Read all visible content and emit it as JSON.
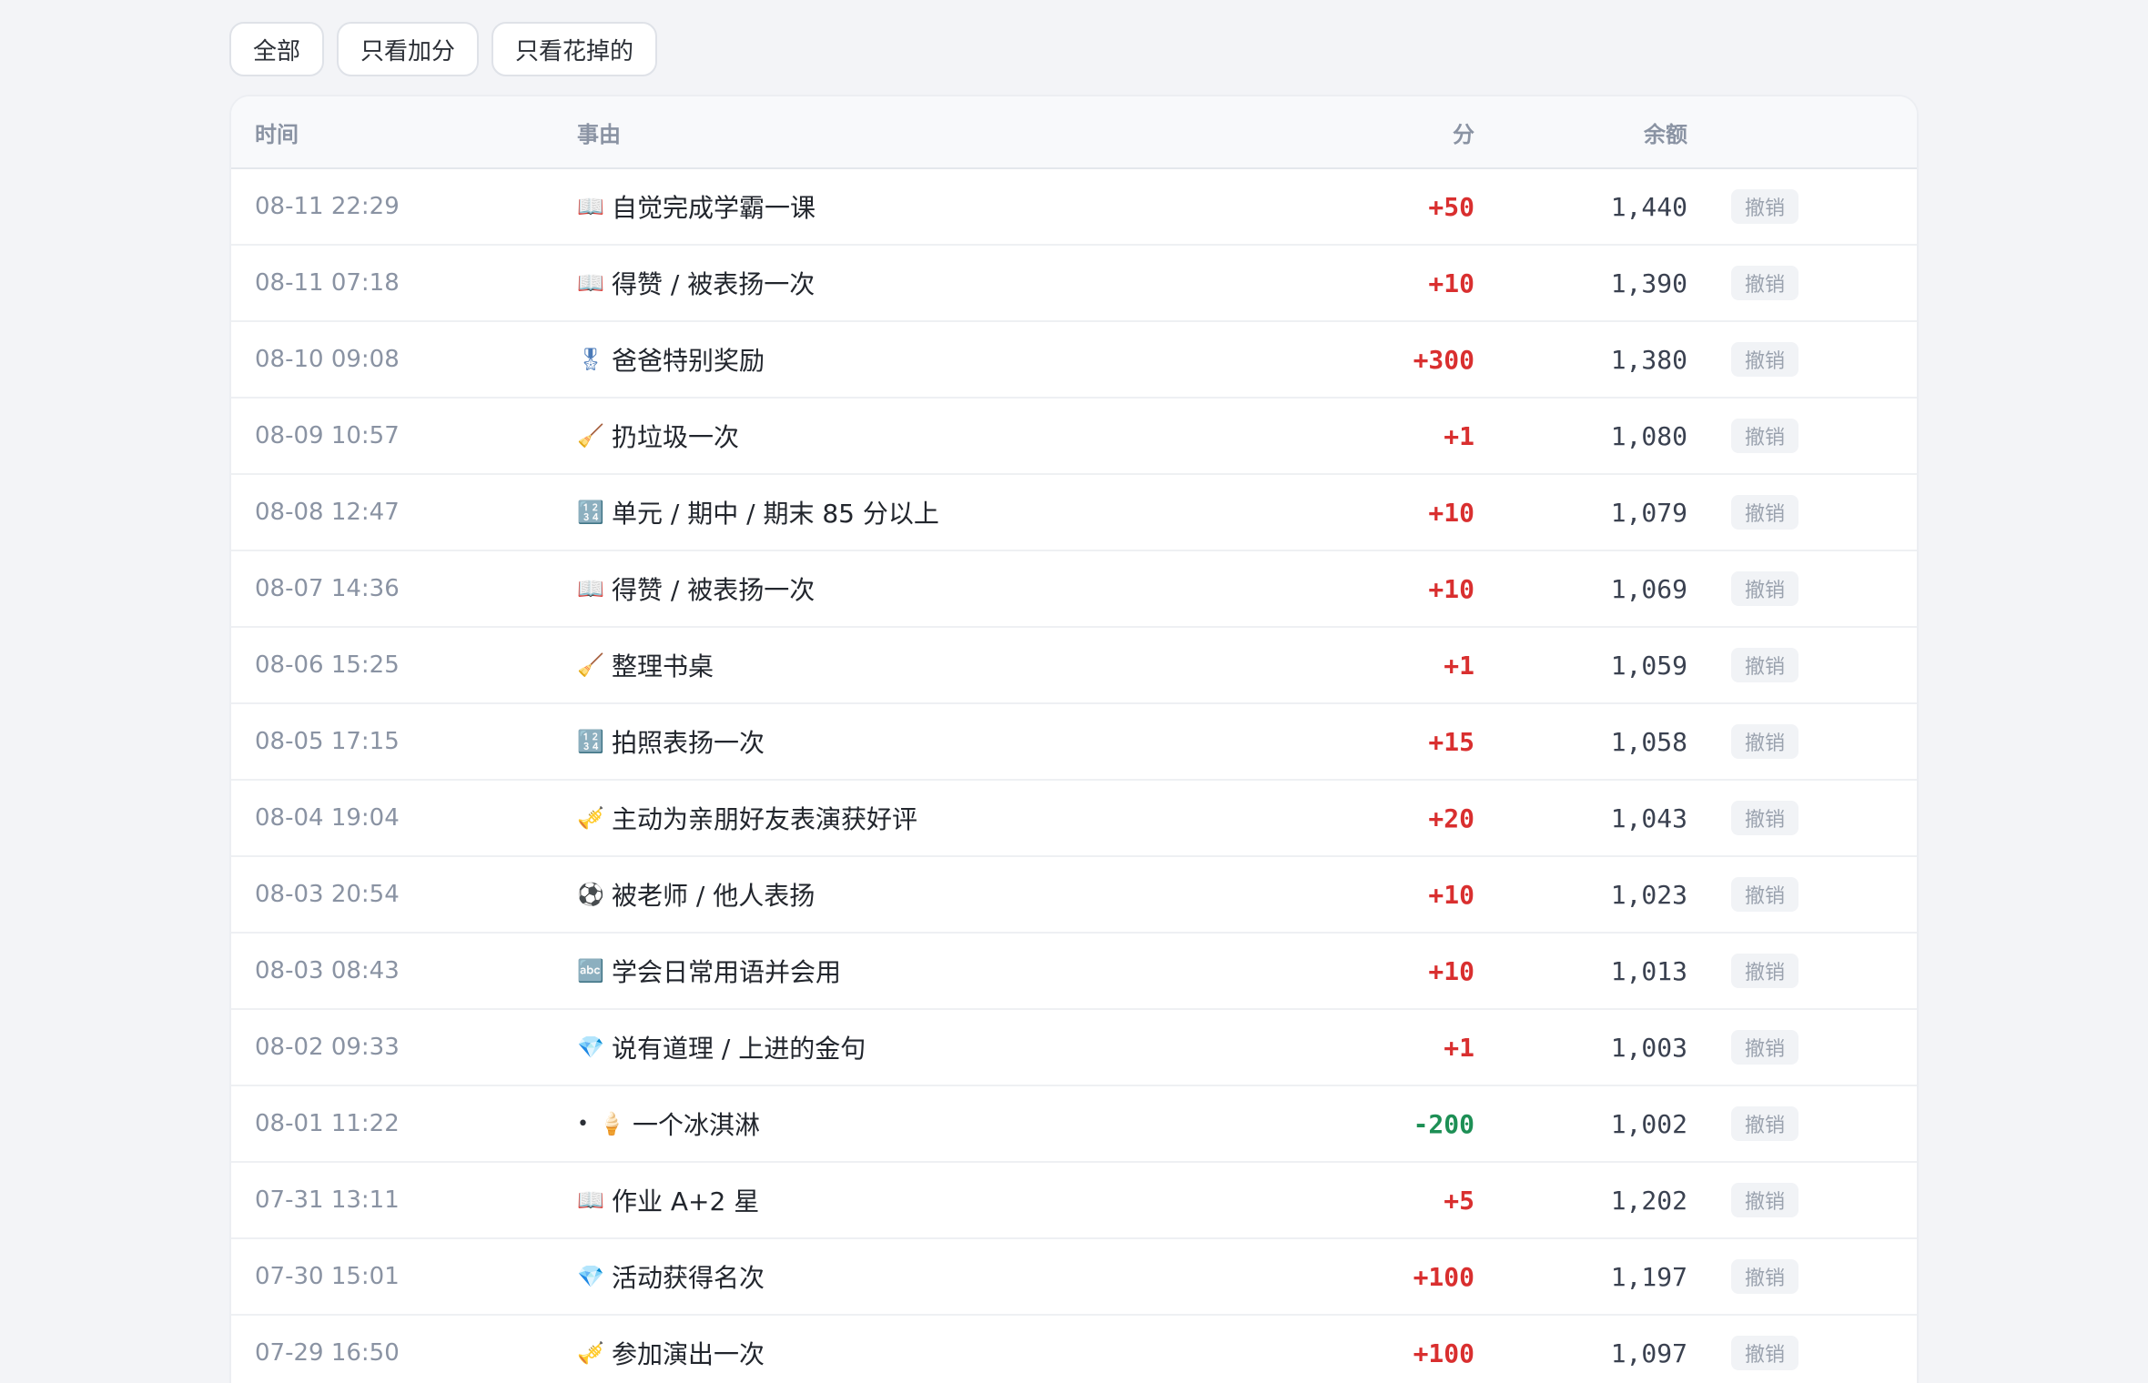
{
  "filters": [
    {
      "label": "全部"
    },
    {
      "label": "只看加分"
    },
    {
      "label": "只看花掉的"
    }
  ],
  "table": {
    "headers": {
      "time": "时间",
      "reason": "事由",
      "delta": "分",
      "balance": "余额"
    },
    "undo_label": "撤销",
    "rows": [
      {
        "time": "08-11 22:29",
        "icon": "book-icon",
        "glyph": "📖",
        "bullet": "",
        "reason": "自觉完成学霸一课",
        "delta": "+50",
        "sign": "pos",
        "balance": "1,440"
      },
      {
        "time": "08-11 07:18",
        "icon": "book-icon",
        "glyph": "📖",
        "bullet": "",
        "reason": "得赞 / 被表扬一次",
        "delta": "+10",
        "sign": "pos",
        "balance": "1,390"
      },
      {
        "time": "08-10 09:08",
        "icon": "medal-icon",
        "glyph": "🎖",
        "bullet": "",
        "reason": "爸爸特别奖励",
        "delta": "+300",
        "sign": "pos",
        "balance": "1,380"
      },
      {
        "time": "08-09 10:57",
        "icon": "broom-icon",
        "glyph": "🧹",
        "bullet": "",
        "reason": "扔垃圾一次",
        "delta": "+1",
        "sign": "pos",
        "balance": "1,080"
      },
      {
        "time": "08-08 12:47",
        "icon": "numbers-icon",
        "glyph": "🔢",
        "bullet": "",
        "reason": "单元 / 期中 / 期末 85 分以上",
        "delta": "+10",
        "sign": "pos",
        "balance": "1,079"
      },
      {
        "time": "08-07 14:36",
        "icon": "book-icon",
        "glyph": "📖",
        "bullet": "",
        "reason": "得赞 / 被表扬一次",
        "delta": "+10",
        "sign": "pos",
        "balance": "1,069"
      },
      {
        "time": "08-06 15:25",
        "icon": "broom-icon",
        "glyph": "🧹",
        "bullet": "",
        "reason": "整理书桌",
        "delta": "+1",
        "sign": "pos",
        "balance": "1,059"
      },
      {
        "time": "08-05 17:15",
        "icon": "numbers-icon",
        "glyph": "🔢",
        "bullet": "",
        "reason": "拍照表扬一次",
        "delta": "+15",
        "sign": "pos",
        "balance": "1,058"
      },
      {
        "time": "08-04 19:04",
        "icon": "trumpet-icon",
        "glyph": "🎺",
        "bullet": "",
        "reason": "主动为亲朋好友表演获好评",
        "delta": "+20",
        "sign": "pos",
        "balance": "1,043"
      },
      {
        "time": "08-03 20:54",
        "icon": "soccer-ball-icon",
        "glyph": "⚽",
        "bullet": "",
        "reason": "被老师 / 他人表扬",
        "delta": "+10",
        "sign": "pos",
        "balance": "1,023"
      },
      {
        "time": "08-03 08:43",
        "icon": "abc-icon",
        "glyph": "🔤",
        "bullet": "",
        "reason": "学会日常用语并会用",
        "delta": "+10",
        "sign": "pos",
        "balance": "1,013"
      },
      {
        "time": "08-02 09:33",
        "icon": "gem-icon",
        "glyph": "💎",
        "bullet": "",
        "reason": "说有道理 / 上进的金句",
        "delta": "+1",
        "sign": "pos",
        "balance": "1,003"
      },
      {
        "time": "08-01 11:22",
        "icon": "ice-cream-icon",
        "glyph": "🍦",
        "bullet": "•",
        "reason": "一个冰淇淋",
        "delta": "-200",
        "sign": "neg",
        "balance": "1,002"
      },
      {
        "time": "07-31 13:11",
        "icon": "book-icon",
        "glyph": "📖",
        "bullet": "",
        "reason": "作业 A+2 星",
        "delta": "+5",
        "sign": "pos",
        "balance": "1,202"
      },
      {
        "time": "07-30 15:01",
        "icon": "gem-icon",
        "glyph": "💎",
        "bullet": "",
        "reason": "活动获得名次",
        "delta": "+100",
        "sign": "pos",
        "balance": "1,197"
      },
      {
        "time": "07-29 16:50",
        "icon": "trumpet-icon",
        "glyph": "🎺",
        "bullet": "",
        "reason": "参加演出一次",
        "delta": "+100",
        "sign": "pos",
        "balance": "1,097"
      }
    ]
  }
}
